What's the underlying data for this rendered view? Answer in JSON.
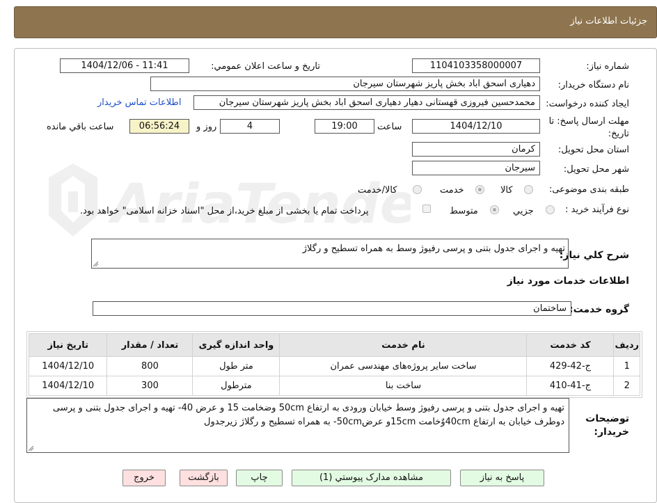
{
  "header": {
    "title": "جزئیات اطلاعات نیاز"
  },
  "form": {
    "need_number_label": "شماره نیاز:",
    "need_number": "1104103358000007",
    "announce_label": "تاریخ و ساعت اعلان عمومي:",
    "announce_value": "1404/12/06 - 11:41",
    "buyer_org_label": "نام دستگاه خریدار:",
    "buyer_org": "دهیاری اسحق اباد بخش پاریز شهرستان سیرجان",
    "creator_label": "ایجاد کننده درخواست:",
    "creator": "محمدحسین فیروزی قهستانی دهیار دهیاری اسحق اباد بخش پاریز شهرستان سیرجان",
    "contact_link": "اطلاعات تماس خریدار",
    "deadline_label_1": "مهلت ارسال پاسخ: تا",
    "deadline_label_2": "تاریخ:",
    "deadline_date": "1404/12/10",
    "time_label": "ساعت",
    "deadline_time": "19:00",
    "days_value": "4",
    "days_label": "روز و",
    "remaining_time": "06:56:24",
    "remaining_label": "ساعت باقي مانده",
    "province_label": "استان محل تحویل:",
    "province": "کرمان",
    "city_label": "شهر محل تحویل:",
    "city": "سیرجان",
    "category_label": "طبقه بندی موضوعی:",
    "category_options": [
      "کالا",
      "خدمت",
      "کالا/خدمت"
    ],
    "category_selected": "خدمت",
    "process_label": "نوع فرآیند خرید :",
    "process_options": [
      "جزيي",
      "متوسط"
    ],
    "process_selected": "متوسط",
    "payment_note": "پرداخت تمام یا بخشی از مبلغ خرید،از محل \"اسناد خزانه اسلامی\" خواهد بود.",
    "summary_label": "شرح کلي نیاز:",
    "summary": "تهیه و اجرای جدول بتنی و پرسی رفیوژ وسط به همراه تسطیح و رگلاژ",
    "services_heading": "اطلاعات خدمات مورد نیاز",
    "service_group_label": "گروه خدمت:",
    "service_group": "ساختمان"
  },
  "table": {
    "headers": [
      "ردیف",
      "کد خدمت",
      "نام خدمت",
      "واحد اندازه گیری",
      "تعداد / مقدار",
      "تاریخ نیاز"
    ],
    "rows": [
      {
        "row": "1",
        "code": "ج-42-429",
        "name": "ساخت سایر پروژه‌های مهندسی عمران",
        "unit": "متر طول",
        "qty": "800",
        "date": "1404/12/10"
      },
      {
        "row": "2",
        "code": "ج-41-410",
        "name": "ساخت بنا",
        "unit": "مترطول",
        "qty": "300",
        "date": "1404/12/10"
      }
    ]
  },
  "notes": {
    "label_1": "توضیحات",
    "label_2": "خریدار:",
    "text": "تهیه و اجرای جدول بتنی و پرسی رفیوژ وسط خیابان ورودی به ارتفاع 50cm وضخامت 15 و عرض 40- تهیه و اجرای جدول بتنی و پرسی دوطرف خیابان به ارتفاع 40cmوٌخامت 15cmو عرض50cm- به همراه تسطیح و رگلاژ زیرجدول"
  },
  "buttons": {
    "reply": "پاسخ به نیاز",
    "attachments": "مشاهده مدارک پیوستي (1)",
    "print": "چاپ",
    "back": "بازگشت",
    "exit": "خروج"
  },
  "watermark": {
    "text": "AriaTender.neT"
  },
  "colors": {
    "header_bg": "#8e7550",
    "link": "#1d4fc4",
    "green_button": "#e3fbe3",
    "pink_button": "#ffe0e0",
    "remaining_bg": "#f7f3c8"
  }
}
